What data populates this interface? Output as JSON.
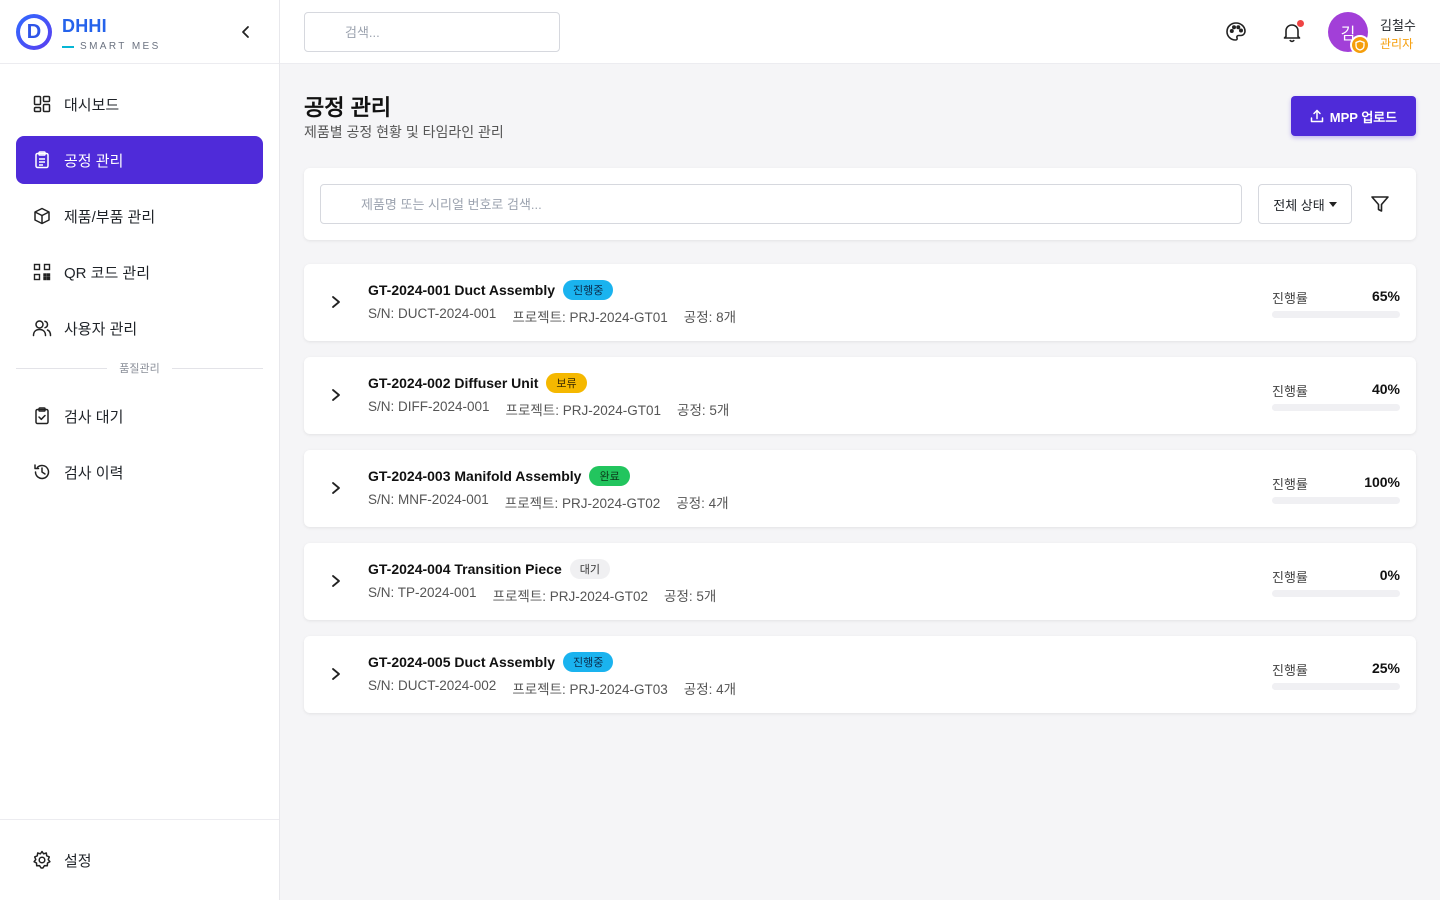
{
  "brand": {
    "name": "DHHI",
    "sub": "SMART MES",
    "logo_letter": "D"
  },
  "colors": {
    "accent": "#4f2bd9",
    "brand_blue": "#2563eb",
    "role": "#f59e0b"
  },
  "sidebar": {
    "items": [
      {
        "label": "대시보드",
        "icon": "dashboard-icon"
      },
      {
        "label": "공정 관리",
        "icon": "clipboard-icon",
        "active": true
      },
      {
        "label": "제품/부품 관리",
        "icon": "box-icon"
      },
      {
        "label": "QR 코드 관리",
        "icon": "qr-icon"
      },
      {
        "label": "사용자 관리",
        "icon": "users-icon"
      }
    ],
    "section_label": "품질관리",
    "quality_items": [
      {
        "label": "검사 대기",
        "icon": "clipboard-check-icon"
      },
      {
        "label": "검사 이력",
        "icon": "history-icon"
      }
    ],
    "settings_label": "설정"
  },
  "header": {
    "search_placeholder": "검색...",
    "user": {
      "name": "김철수",
      "role": "관리자",
      "avatar_letter": "김"
    }
  },
  "main": {
    "title": "공정 관리",
    "subtitle": "제품별 공정 현황 및 타임라인 관리",
    "upload_label": "MPP 업로드",
    "filter": {
      "search_placeholder": "제품명 또는 시리얼 번호로 검색...",
      "status_label": "전체 상태"
    },
    "progress_label": "진행률",
    "processes": [
      {
        "title": "GT-2024-001 Duct Assembly",
        "status": "진행중",
        "status_bg": "#1ab3ef",
        "status_fg": "#0b2a4a",
        "sn": "S/N: DUCT-2024-001",
        "project": "프로젝트: PRJ-2024-GT01",
        "steps": "공정: 8개",
        "progress_text": "65%",
        "progress": 65
      },
      {
        "title": "GT-2024-002 Diffuser Unit",
        "status": "보류",
        "status_bg": "#f5b800",
        "status_fg": "#3a2a00",
        "sn": "S/N: DIFF-2024-001",
        "project": "프로젝트: PRJ-2024-GT01",
        "steps": "공정: 5개",
        "progress_text": "40%",
        "progress": 40
      },
      {
        "title": "GT-2024-003 Manifold Assembly",
        "status": "완료",
        "status_bg": "#22c55e",
        "status_fg": "#0b3a1a",
        "sn": "S/N: MNF-2024-001",
        "project": "프로젝트: PRJ-2024-GT02",
        "steps": "공정: 4개",
        "progress_text": "100%",
        "progress": 100
      },
      {
        "title": "GT-2024-004 Transition Piece",
        "status": "대기",
        "status_bg": "#f0f0f2",
        "status_fg": "#333333",
        "sn": "S/N: TP-2024-001",
        "project": "프로젝트: PRJ-2024-GT02",
        "steps": "공정: 5개",
        "progress_text": "0%",
        "progress": 0
      },
      {
        "title": "GT-2024-005 Duct Assembly",
        "status": "진행중",
        "status_bg": "#1ab3ef",
        "status_fg": "#0b2a4a",
        "sn": "S/N: DUCT-2024-002",
        "project": "프로젝트: PRJ-2024-GT03",
        "steps": "공정: 4개",
        "progress_text": "25%",
        "progress": 25
      }
    ]
  }
}
